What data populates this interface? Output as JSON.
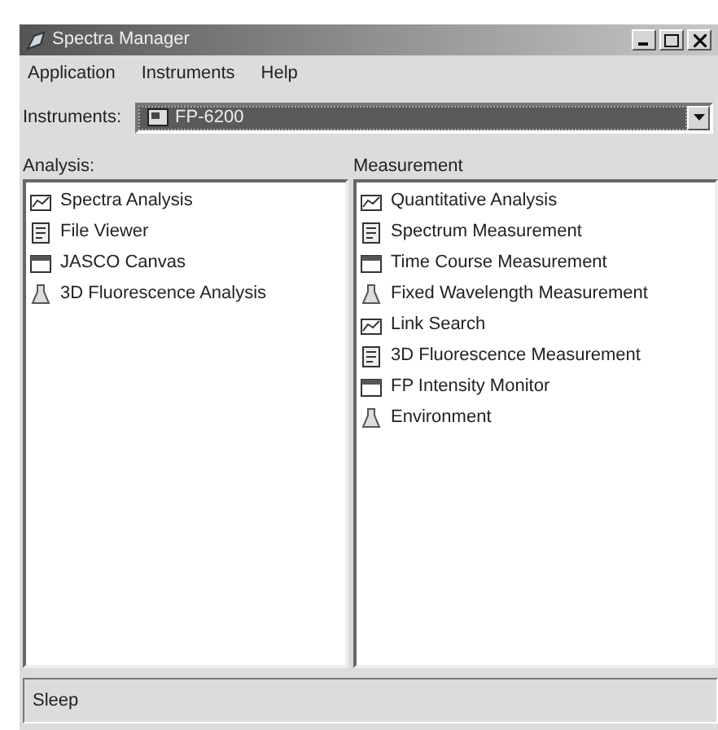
{
  "window": {
    "title": "Spectra Manager"
  },
  "menu": [
    "Application",
    "Instruments",
    "Help"
  ],
  "instrument": {
    "label": "Instruments:",
    "value": "FP-6200"
  },
  "analysis": {
    "label": "Analysis:",
    "items": [
      {
        "text": "Spectra Analysis",
        "selected": false
      },
      {
        "text": "File Viewer",
        "selected": false
      },
      {
        "text": "JASCO Canvas",
        "selected": false
      },
      {
        "text": "3D Fluorescence Analysis",
        "selected": false
      }
    ]
  },
  "measurement": {
    "label": "Measurement",
    "items": [
      {
        "text": "Quantitative Analysis",
        "selected": false
      },
      {
        "text": "Spectrum Measurement",
        "selected": false
      },
      {
        "text": "Time Course Measurement",
        "selected": false
      },
      {
        "text": "Fixed Wavelength Measurement",
        "selected": false
      },
      {
        "text": "Link Search",
        "selected": false
      },
      {
        "text": "3D Fluorescence Measurement",
        "selected": false
      },
      {
        "text": "FP Intensity Monitor",
        "selected": false
      },
      {
        "text": "Environment",
        "selected": false
      }
    ]
  },
  "status_bar": "Sleep"
}
